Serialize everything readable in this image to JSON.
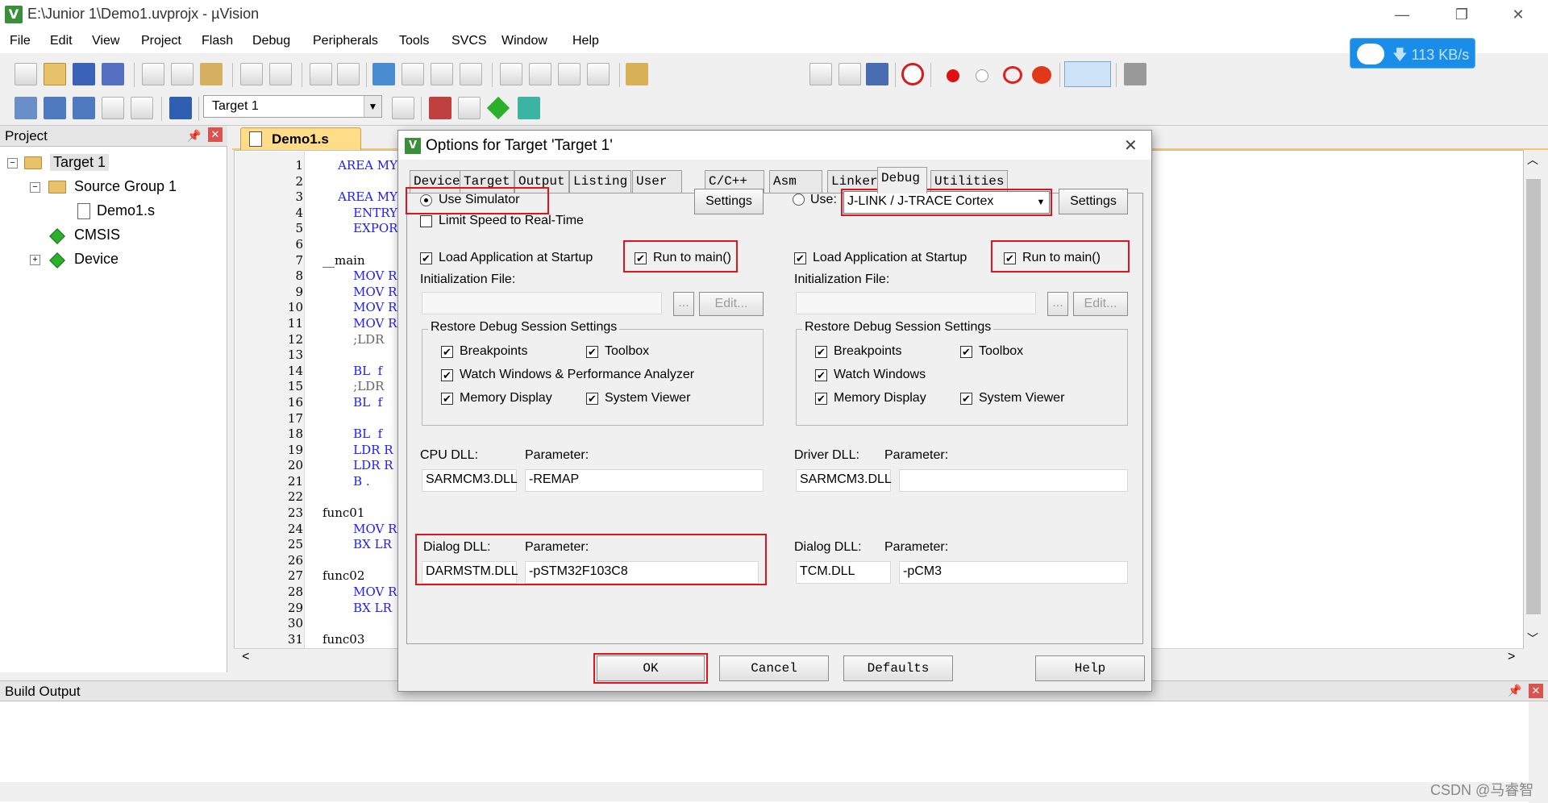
{
  "window": {
    "title": "E:\\Junior 1\\Demo1.uvprojx - µVision",
    "app_icon": "uvision-icon",
    "minimize_glyph": "—",
    "restore_glyph": "❐",
    "close_glyph": "✕"
  },
  "menu": [
    "File",
    "Edit",
    "View",
    "Project",
    "Flash",
    "Debug",
    "Peripherals",
    "Tools",
    "SVCS",
    "Window",
    "Help"
  ],
  "toolbar": {
    "target_select": "Target 1",
    "speed": "113 KB/s",
    "speed_arrow": "🡇"
  },
  "project_pane": {
    "title": "Project",
    "pin": "📌",
    "close": "✕",
    "tree": {
      "target": "Target 1",
      "group": "Source Group 1",
      "file": "Demo1.s",
      "cmsis": "CMSIS",
      "device": "Device",
      "minus": "−",
      "plus": "+"
    }
  },
  "editor": {
    "tab": "Demo1.s",
    "line_numbers": [
      "1",
      "2",
      "3",
      "4",
      "5",
      "6",
      "7",
      "8",
      "9",
      "10",
      "11",
      "12",
      "13",
      "14",
      "15",
      "16",
      "17",
      "18",
      "19",
      "20",
      "21",
      "22",
      "23",
      "24",
      "25",
      "26",
      "27",
      "28",
      "29",
      "30",
      "31"
    ],
    "lines": [
      "    AREA MYI",
      "",
      "    AREA MYC",
      "        ENTRY",
      "        EXPOR",
      "",
      "__main",
      "        MOV R",
      "        MOV R",
      "        MOV R",
      "        MOV R",
      "        ;LDR",
      "",
      "        BL  f",
      "        ;LDR",
      "        BL  f",
      "",
      "        BL  f",
      "        LDR R",
      "        LDR R",
      "        B .",
      "",
      "func01",
      "        MOV R",
      "        BX LR",
      "",
      "func02",
      "        MOV R",
      "        BX LR",
      "",
      "func03"
    ],
    "scroll_up": "︿",
    "scroll_down": "﹀",
    "scroll_left": "<",
    "scroll_right": ">"
  },
  "build_output": {
    "title": "Build Output",
    "pin": "📌",
    "close": "✕"
  },
  "watermark": "CSDN @马睿智",
  "dialog": {
    "title": "Options for Target 'Target 1'",
    "close": "✕",
    "tabs": [
      "Device",
      "Target",
      "Output",
      "Listing",
      "User",
      "C/C++",
      "Asm",
      "Linker",
      "Debug",
      "Utilities"
    ],
    "left": {
      "use_simulator": "Use Simulator",
      "limit_speed": "Limit Speed to Real-Time",
      "settings": "Settings",
      "load_app": "Load Application at Startup",
      "run_to_main": "Run to main()",
      "init_file": "Initialization File:",
      "browse": "...",
      "edit": "Edit...",
      "restore_title": "Restore Debug Session Settings",
      "breakpoints": "Breakpoints",
      "toolbox": "Toolbox",
      "watch_windows": "Watch Windows & Performance Analyzer",
      "memory_display": "Memory Display",
      "system_viewer": "System Viewer",
      "cpu_dll_label": "CPU DLL:",
      "cpu_param_label": "Parameter:",
      "cpu_dll": "SARMCM3.DLL",
      "cpu_param": "-REMAP",
      "dialog_dll_label": "Dialog DLL:",
      "dialog_param_label": "Parameter:",
      "dialog_dll": "DARMSTM.DLL",
      "dialog_param": "-pSTM32F103C8"
    },
    "right": {
      "use": "Use:",
      "driver": "J-LINK / J-TRACE Cortex",
      "settings": "Settings",
      "load_app": "Load Application at Startup",
      "run_to_main": "Run to main()",
      "init_file": "Initialization File:",
      "browse": "...",
      "edit": "Edit...",
      "restore_title": "Restore Debug Session Settings",
      "breakpoints": "Breakpoints",
      "toolbox": "Toolbox",
      "watch_windows": "Watch Windows",
      "memory_display": "Memory Display",
      "system_viewer": "System Viewer",
      "driver_dll_label": "Driver DLL:",
      "driver_param_label": "Parameter:",
      "driver_dll": "SARMCM3.DLL",
      "driver_param": "",
      "dialog_dll_label": "Dialog DLL:",
      "dialog_param_label": "Parameter:",
      "dialog_dll": "TCM.DLL",
      "dialog_param": "-pCM3"
    },
    "check_glyph": "✔",
    "dropdown_glyph": "▼",
    "buttons": {
      "ok": "OK",
      "cancel": "Cancel",
      "defaults": "Defaults",
      "help": "Help"
    }
  }
}
